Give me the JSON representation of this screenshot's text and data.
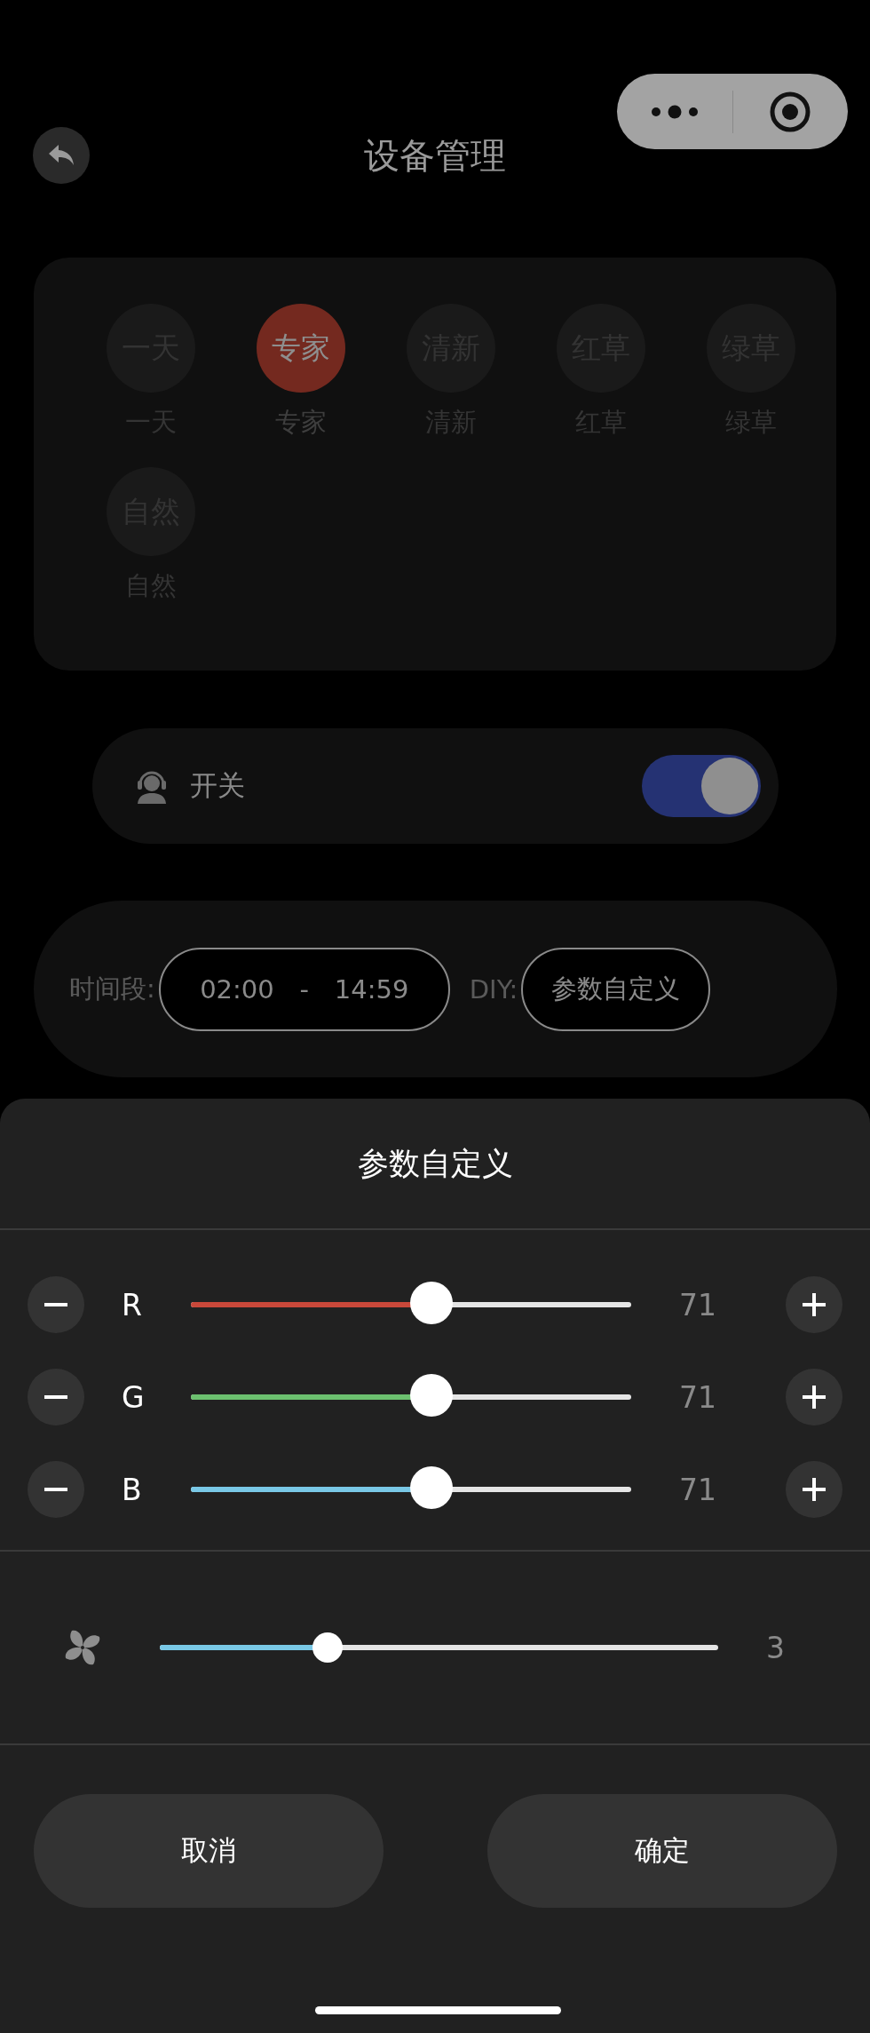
{
  "header": {
    "title": "设备管理"
  },
  "modes": [
    {
      "icon_text": "一天",
      "label": "一天",
      "selected": false
    },
    {
      "icon_text": "专家",
      "label": "专家",
      "selected": true
    },
    {
      "icon_text": "清新",
      "label": "清新",
      "selected": false
    },
    {
      "icon_text": "红草",
      "label": "红草",
      "selected": false
    },
    {
      "icon_text": "绿草",
      "label": "绿草",
      "selected": false
    },
    {
      "icon_text": "自然",
      "label": "自然",
      "selected": false
    }
  ],
  "power": {
    "label": "开关",
    "on": true
  },
  "schedule": {
    "label": "时间段:",
    "start": "02:00",
    "separator": "-",
    "end": "14:59",
    "diy_label": "DIY:",
    "diy_button": "参数自定义"
  },
  "sheet": {
    "title": "参数自定义",
    "channels": [
      {
        "name": "R",
        "color": "#c9483a",
        "level": 0.546,
        "reading": "71"
      },
      {
        "name": "G",
        "color": "#6cc16f",
        "level": 0.546,
        "reading": "71"
      },
      {
        "name": "B",
        "color": "#79c8e6",
        "level": 0.546,
        "reading": "71"
      }
    ],
    "fan": {
      "color": "#79c8e6",
      "level": 0.3,
      "reading": "3"
    },
    "buttons": [
      "取消",
      "确定"
    ]
  }
}
